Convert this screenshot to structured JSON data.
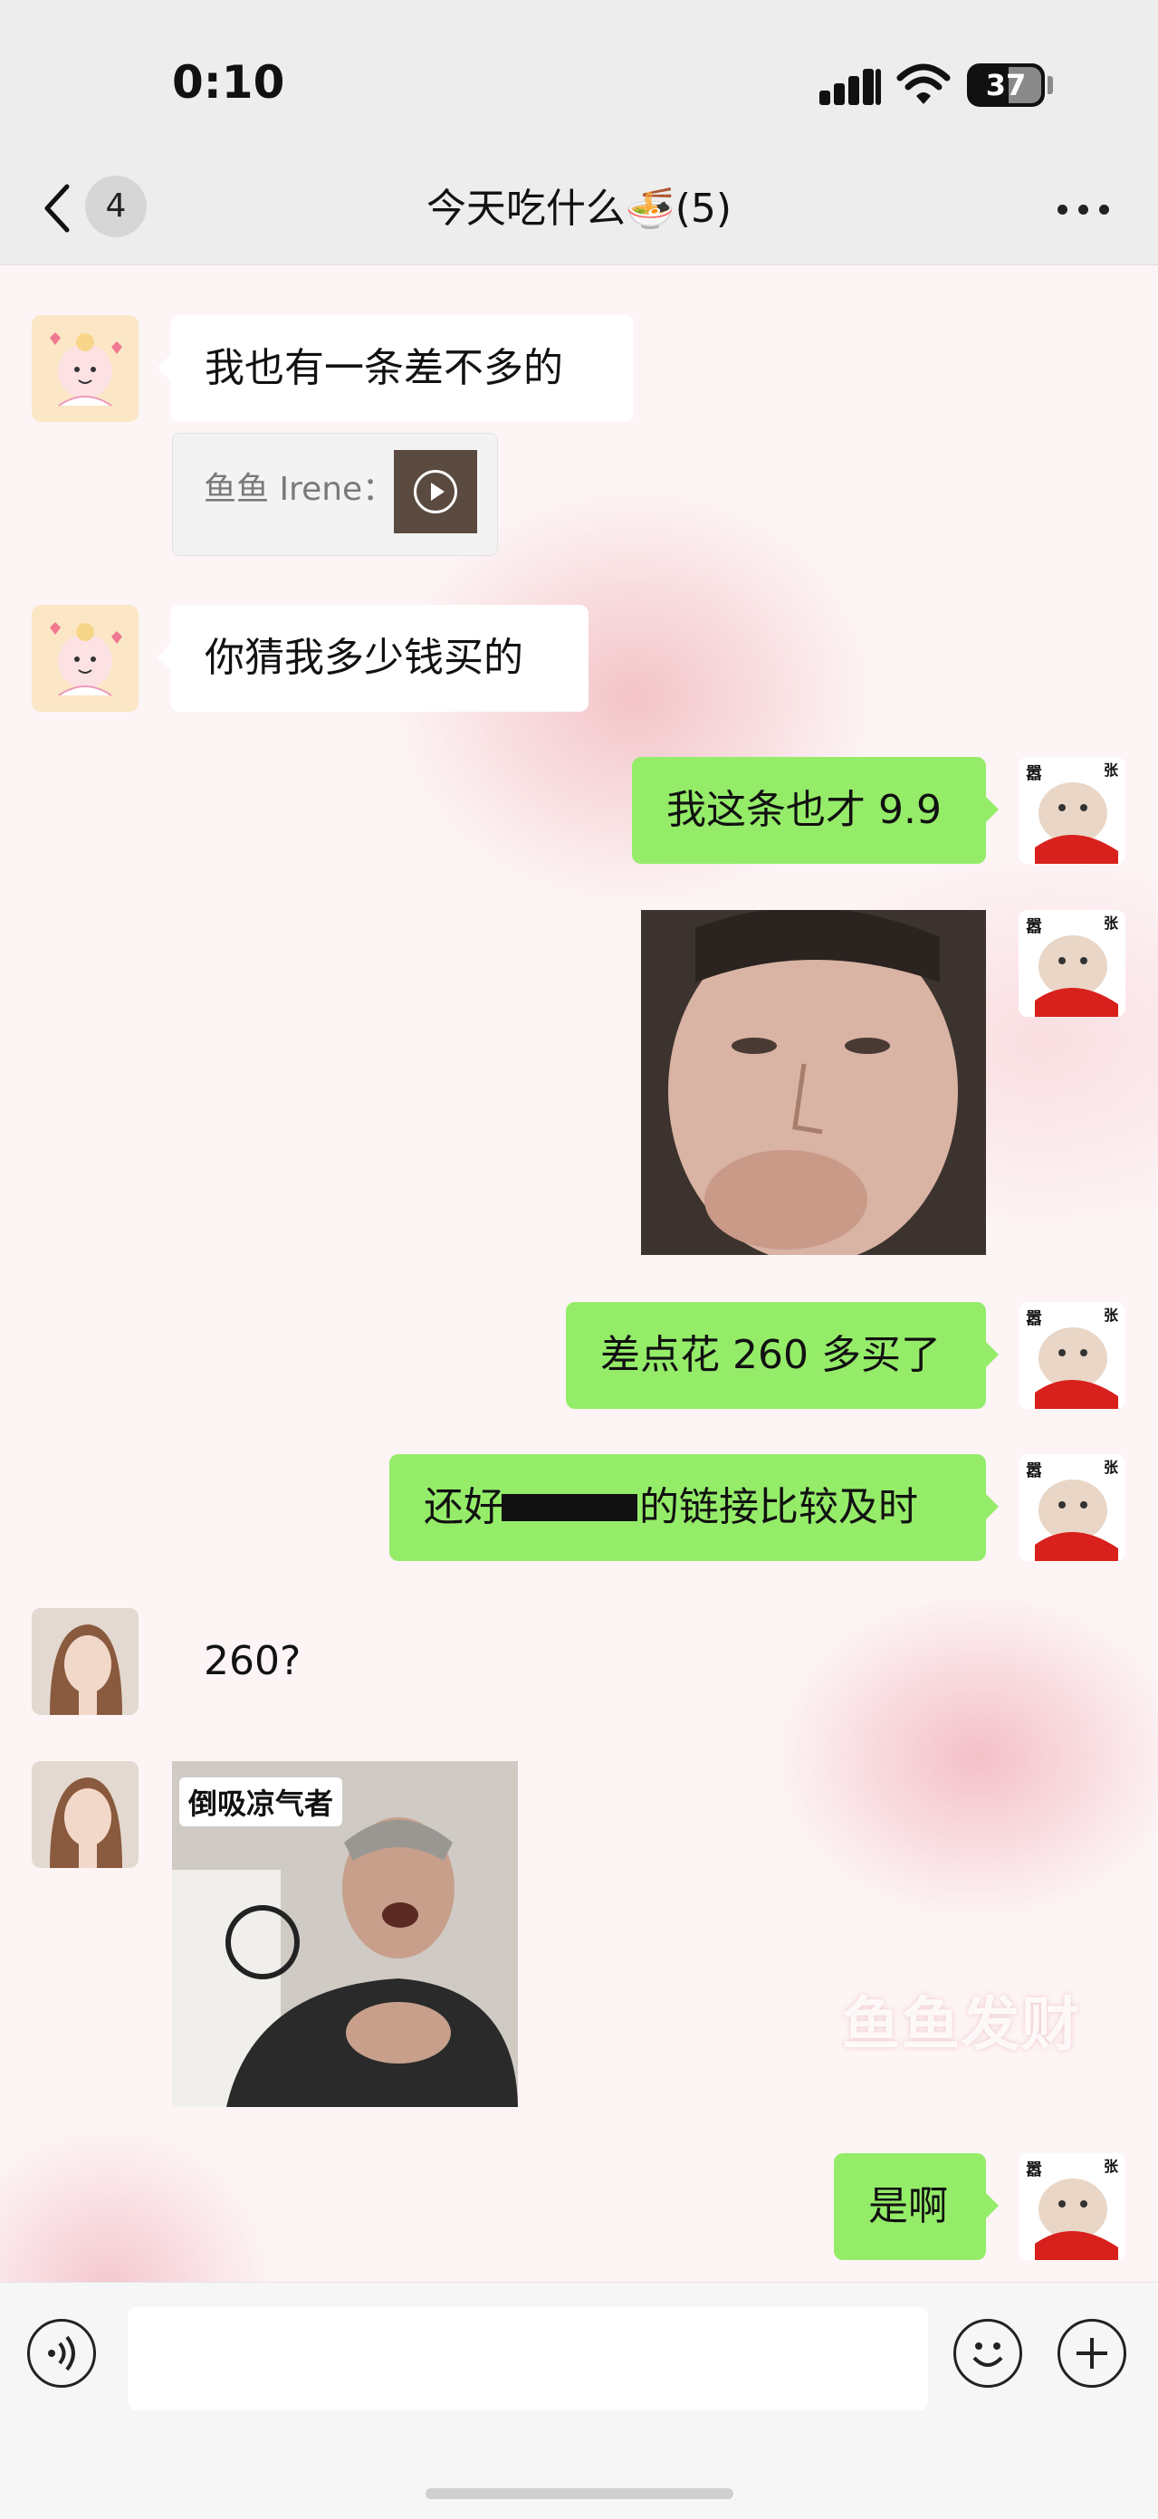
{
  "status_bar": {
    "time": "0:10",
    "battery": "37",
    "icons": [
      "cellular-signal-icon",
      "wifi-icon",
      "battery-icon"
    ]
  },
  "nav": {
    "back_icon": "chevron-left-icon",
    "unread_count": "4",
    "title": "今天吃什么🍜(5)",
    "more_icon": "more-dots-icon"
  },
  "messages": [
    {
      "side": "in",
      "avatar": "angel-avatar",
      "text": "我也有一条差不多的"
    },
    {
      "side": "in",
      "type": "quote",
      "quote_text": "鱼鱼 Irene：",
      "thumb_icon": "play-icon"
    },
    {
      "side": "in",
      "avatar": "angel-avatar",
      "text": "你猜我多少钱买的"
    },
    {
      "side": "out",
      "avatar": "cat-avatar",
      "text": "我这条也才 9.9"
    },
    {
      "side": "out",
      "avatar": "cat-avatar",
      "type": "image",
      "image": "meme-face"
    },
    {
      "side": "out",
      "avatar": "cat-avatar",
      "text": "差点花 260 多买了"
    },
    {
      "side": "out",
      "avatar": "cat-avatar",
      "text_before": "还好",
      "text_after": "的链接比较及时",
      "redacted": true
    },
    {
      "side": "in",
      "avatar": "girl-avatar",
      "text": "260?"
    },
    {
      "side": "in",
      "avatar": "girl-avatar",
      "type": "image",
      "image": "sticker-gasp",
      "caption": "倒吸凉气者"
    },
    {
      "side": "out",
      "avatar": "cat-avatar",
      "text": "是啊"
    }
  ],
  "avatar_text": {
    "cat": "嚣",
    "cat2": "张"
  },
  "watermark": "鱼鱼发财",
  "input_bar": {
    "voice_icon": "voice-icon",
    "emoji_icon": "emoji-icon",
    "plus_icon": "plus-icon",
    "value": ""
  },
  "colors": {
    "outgoing_bubble": "#95ec69",
    "incoming_bubble": "#ffffff",
    "header_bg": "#ededed"
  }
}
